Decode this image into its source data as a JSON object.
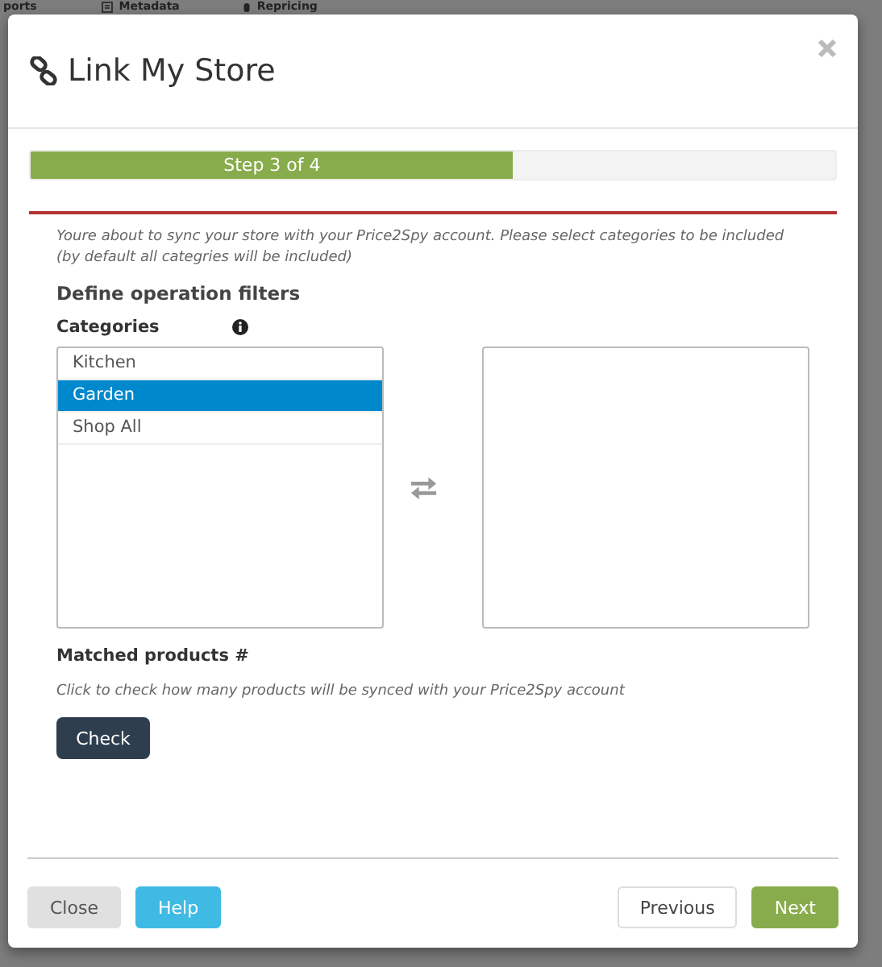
{
  "background_nav": [
    {
      "label": "ports",
      "kind": "text"
    },
    {
      "label": "Metadata",
      "kind": "document"
    },
    {
      "label": "Repricing",
      "kind": "mouse"
    }
  ],
  "dialog": {
    "title": "Link My Store",
    "progress": {
      "label": "Step 3 of 4",
      "level": 0.6
    },
    "intro": "Youre about to sync your store with your Price2Spy account. Please select categories to be included (by default all categries will be included)",
    "section_title": "Define operation filters",
    "categories_label": "Categories",
    "categories": [
      {
        "label": "Kitchen",
        "selected": false
      },
      {
        "label": "Garden",
        "selected": true
      },
      {
        "label": "Shop All",
        "selected": false
      }
    ],
    "matched_label": "Matched products #",
    "matched_hint": "Click to check how many products will be synced with your Price2Spy account",
    "check_button": "Check",
    "footer_left": [
      {
        "label": "Close",
        "kind": "default"
      },
      {
        "label": "Help",
        "kind": "info"
      }
    ],
    "footer_right": [
      {
        "label": "Previous",
        "kind": "outline"
      },
      {
        "label": "Next",
        "kind": "success"
      }
    ]
  }
}
